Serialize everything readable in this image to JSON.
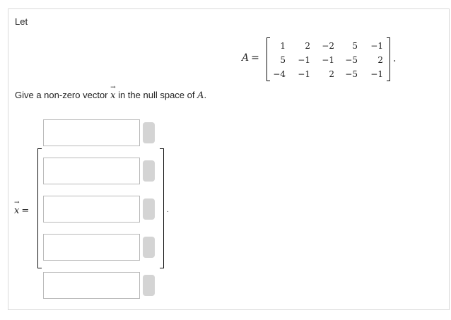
{
  "intro": {
    "let_label": "Let"
  },
  "matrix": {
    "name": "A",
    "equals": "=",
    "rows": [
      [
        "1",
        "2",
        "−2",
        "5",
        "−1"
      ],
      [
        "5",
        "−1",
        "−1",
        "−5",
        "2"
      ],
      [
        "−4",
        "−1",
        "2",
        "−5",
        "−1"
      ]
    ],
    "terminator": "."
  },
  "question": {
    "prefix": "Give a non-zero vector ",
    "vector_symbol": "x",
    "vector_arrow": "→",
    "middle": " in the null space of ",
    "matrix_name": "A",
    "suffix": "."
  },
  "answer": {
    "vector_symbol": "x",
    "vector_arrow": "→",
    "equals": "=",
    "entries": [
      {
        "value": ""
      },
      {
        "value": ""
      },
      {
        "value": ""
      },
      {
        "value": ""
      },
      {
        "value": ""
      }
    ],
    "terminator": "."
  },
  "colors": {
    "panel_border": "#d9d9d9",
    "input_border": "#b9b9b9",
    "entry_button": "#d4d4d4"
  }
}
